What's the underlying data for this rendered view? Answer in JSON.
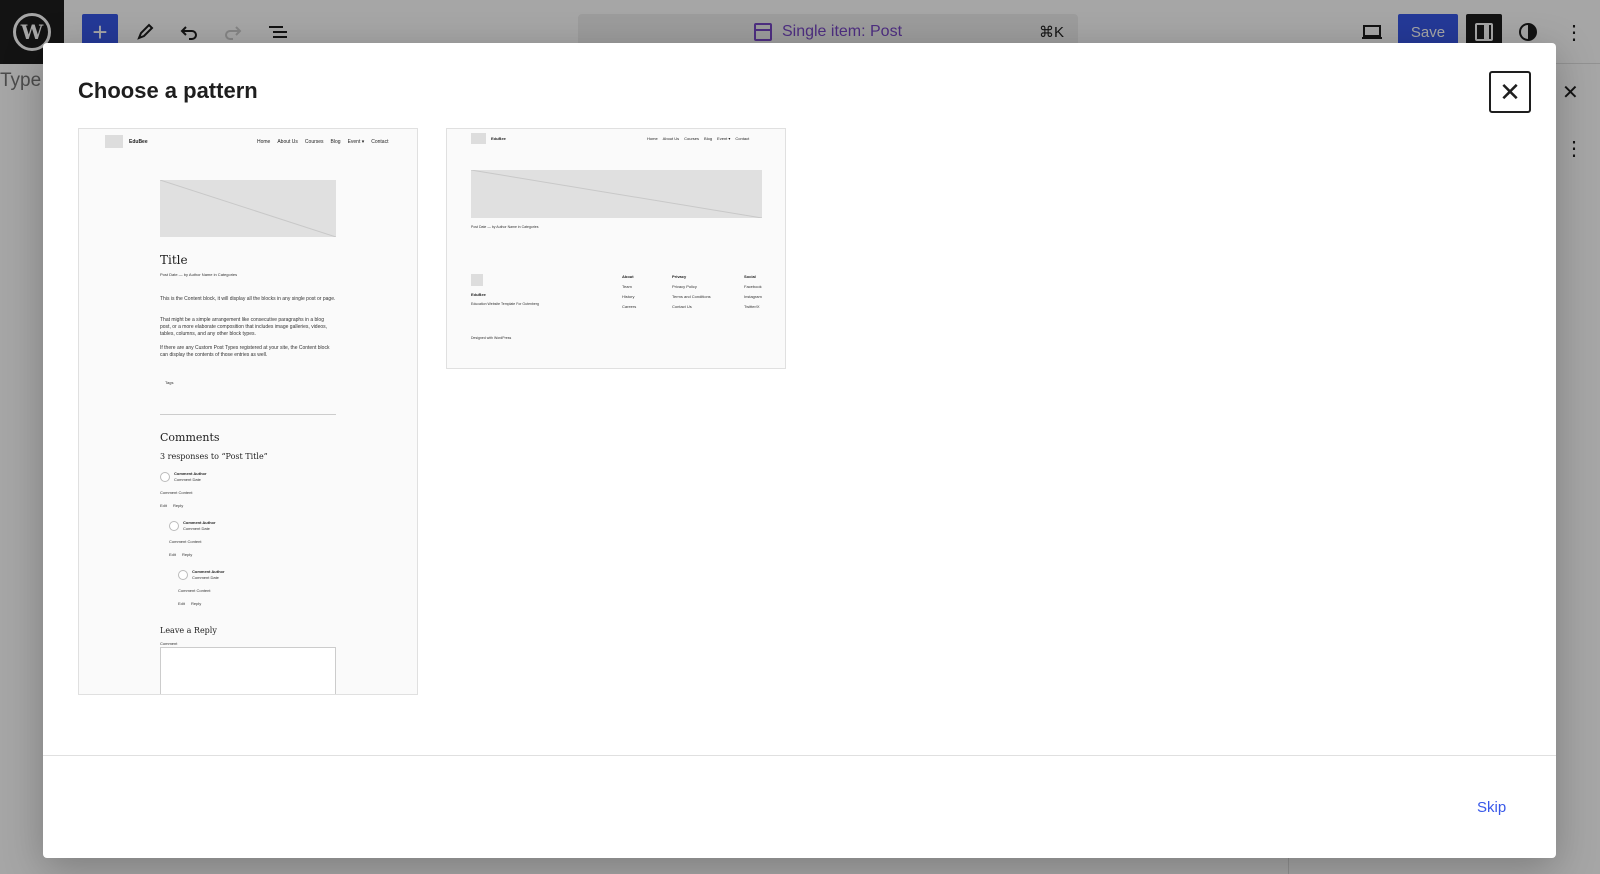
{
  "editor": {
    "command_bar_label": "Single item: Post",
    "command_shortcut": "⌘K",
    "save_label": "Save",
    "title_placeholder": "Type"
  },
  "modal": {
    "title": "Choose a pattern",
    "skip_label": "Skip"
  },
  "patterns": [
    {
      "site_title": "EduBee",
      "nav": [
        "Home",
        "About Us",
        "Courses",
        "Blog",
        "Event ▾",
        "Contact"
      ],
      "post_title": "Title",
      "meta": "Post Date — by Author Name in Categories",
      "paragraphs": [
        "This is the Content block, it will display all the blocks in any single post or page.",
        "That might be a simple arrangement like consecutive paragraphs in a blog post, or a more elaborate composition that includes image galleries, videos, tables, columns, and any other block types.",
        "If there are any Custom Post Types registered at your site, the Content block can display the contents of those entries as well."
      ],
      "tags": "Tags",
      "comments_heading": "Comments",
      "responses": "3 responses to “Post Title”",
      "comment_author": "Comment Author",
      "comment_date": "Comment Date",
      "comment_content": "Comment Content",
      "edit": "Edit",
      "reply": "Reply",
      "leave_reply": "Leave a Reply",
      "comment_label": "Comment"
    },
    {
      "site_title": "EduBee",
      "nav": [
        "Home",
        "About Us",
        "Courses",
        "Blog",
        "Event ▾",
        "Contact"
      ],
      "meta": "Post Date — by Author Name in Categories",
      "footer_site": "EduBee",
      "footer_tagline": "Education Website Template For Gutenberg",
      "footer_columns": [
        {
          "heading": "About",
          "links": [
            "Team",
            "History",
            "Careers"
          ]
        },
        {
          "heading": "Privacy",
          "links": [
            "Privacy Policy",
            "Terms and Conditions",
            "Contact Us"
          ]
        },
        {
          "heading": "Social",
          "links": [
            "Facebook",
            "Instagram",
            "Twitter/X"
          ]
        }
      ],
      "credit": "Designed with WordPress"
    }
  ]
}
